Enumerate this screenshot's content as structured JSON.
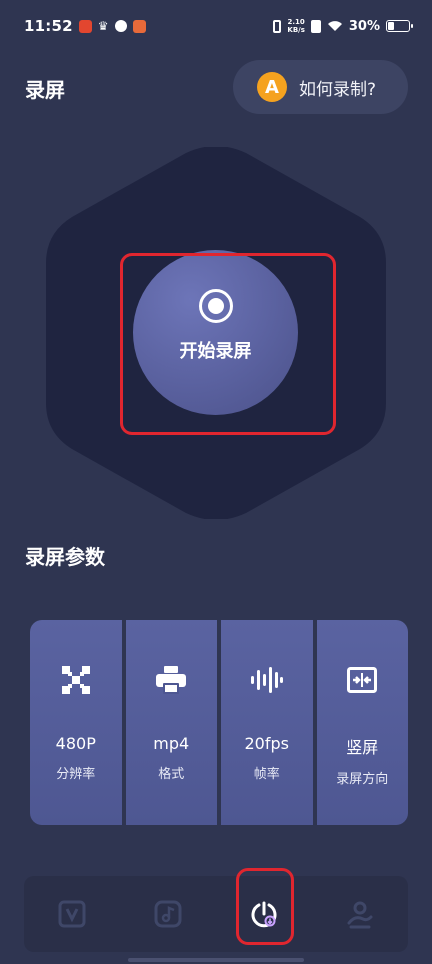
{
  "status_bar": {
    "time": "11:52",
    "net_speed_value": "2.10",
    "net_speed_unit": "KB/s",
    "battery_text": "30%",
    "battery_level": 0.3
  },
  "header": {
    "title": "录屏",
    "help_avatar_letter": "A",
    "help_label": "如何录制?"
  },
  "record": {
    "label": "开始录屏",
    "icon": "record-icon"
  },
  "params": {
    "title": "录屏参数",
    "items": [
      {
        "value": "480P",
        "label": "分辨率",
        "icon": "resolution-icon"
      },
      {
        "value": "mp4",
        "label": "格式",
        "icon": "printer-icon"
      },
      {
        "value": "20fps",
        "label": "帧率",
        "icon": "waveform-icon"
      },
      {
        "value": "竖屏",
        "label": "录屏方向",
        "icon": "orientation-icon"
      }
    ]
  },
  "nav": {
    "items": [
      {
        "icon": "video-icon"
      },
      {
        "icon": "music-icon"
      },
      {
        "icon": "record-power-icon"
      },
      {
        "icon": "profile-icon"
      }
    ]
  },
  "colors": {
    "background": "#2f3551",
    "accent_orange": "#f5a21f",
    "card": "#5a63a1",
    "highlight_red": "#e0262f"
  }
}
